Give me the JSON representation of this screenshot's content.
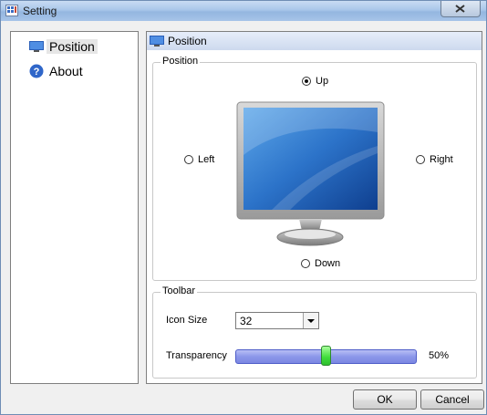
{
  "window": {
    "title": "Setting"
  },
  "sidebar": {
    "items": [
      {
        "label": "Position",
        "icon": "monitor-icon"
      },
      {
        "label": "About",
        "icon": "help-icon"
      }
    ]
  },
  "panel": {
    "header": "Position",
    "position_group": {
      "legend": "Position",
      "options": {
        "up": "Up",
        "left": "Left",
        "right": "Right",
        "down": "Down"
      },
      "selected": "Up"
    },
    "toolbar_group": {
      "legend": "Toolbar",
      "icon_size_label": "Icon Size",
      "icon_size_value": "32",
      "transparency_label": "Transparency",
      "transparency_value": 0.5,
      "transparency_text": "50%"
    }
  },
  "buttons": {
    "ok": "OK",
    "cancel": "Cancel"
  }
}
